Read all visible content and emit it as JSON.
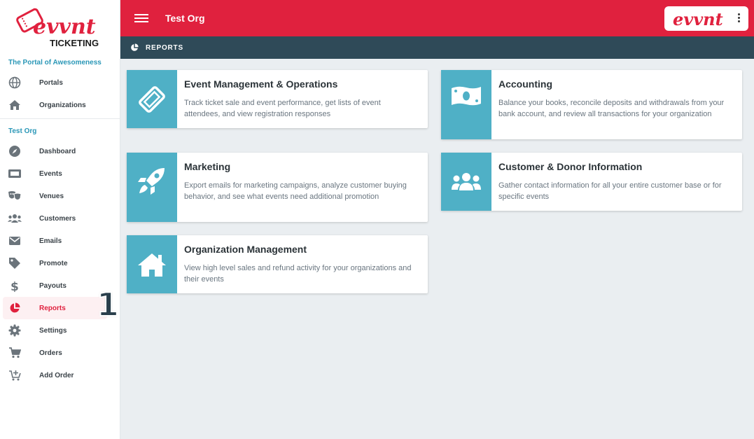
{
  "brand": {
    "logo_text": "evvnt",
    "logo_sub": "TICKETING",
    "header_logo": "evvnt",
    "primary_color": "#e0213e",
    "accent_color": "#4fb0c6",
    "subbar_color": "#2f4a58"
  },
  "sidebar": {
    "section1_label": "The Portal of Awesomeness",
    "section1_items": [
      {
        "label": "Portals",
        "icon": "globe-icon"
      },
      {
        "label": "Organizations",
        "icon": "home-icon"
      }
    ],
    "section2_label": "Test Org",
    "section2_items": [
      {
        "label": "Dashboard",
        "icon": "compass-icon"
      },
      {
        "label": "Events",
        "icon": "ticket-icon"
      },
      {
        "label": "Venues",
        "icon": "theater-masks-icon"
      },
      {
        "label": "Customers",
        "icon": "users-icon"
      },
      {
        "label": "Emails",
        "icon": "envelope-icon"
      },
      {
        "label": "Promote",
        "icon": "tag-icon"
      },
      {
        "label": "Payouts",
        "icon": "dollar-icon"
      },
      {
        "label": "Reports",
        "icon": "pie-chart-icon",
        "active": true
      },
      {
        "label": "Settings",
        "icon": "gear-icon"
      },
      {
        "label": "Orders",
        "icon": "cart-icon"
      },
      {
        "label": "Add Order",
        "icon": "cart-plus-icon"
      }
    ],
    "annotation": "1"
  },
  "header": {
    "title": "Test Org"
  },
  "subheader": {
    "title": "REPORTS"
  },
  "cards": [
    {
      "title": "Event Management & Operations",
      "description": "Track ticket sale and event performance, get lists of event attendees, and view registration responses",
      "icon": "ticket-icon"
    },
    {
      "title": "Accounting",
      "description": "Balance your books, reconcile deposits and withdrawals from your bank account, and review all transactions for your organization",
      "icon": "money-bill-icon"
    },
    {
      "title": "Marketing",
      "description": "Export emails for marketing campaigns, analyze customer buying behavior, and see what events need additional promotion",
      "icon": "rocket-icon"
    },
    {
      "title": "Customer & Donor Information",
      "description": "Gather contact information for all your entire customer base or for specific events",
      "icon": "users-icon"
    },
    {
      "title": "Organization Management",
      "description": "View high level sales and refund activity for your organizations and their events",
      "icon": "home-icon"
    }
  ]
}
